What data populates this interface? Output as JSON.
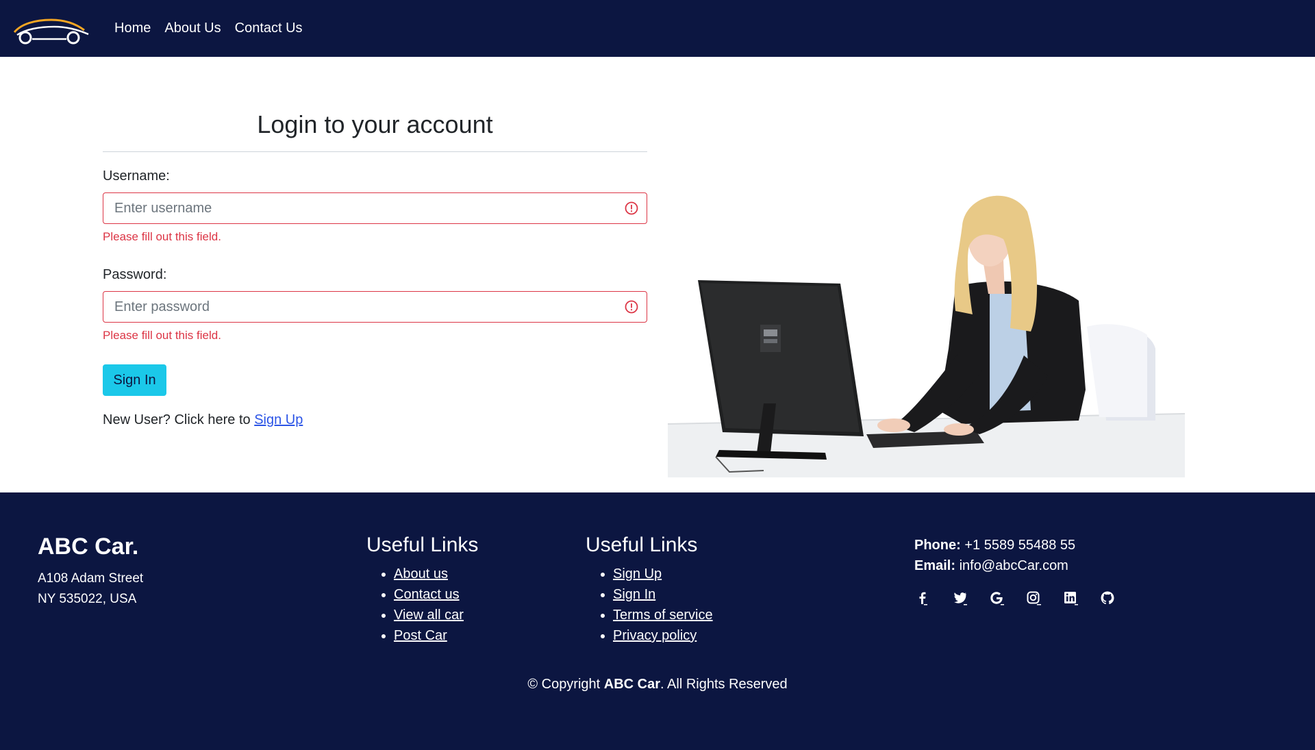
{
  "nav": {
    "logo_icon": "car-logo-icon",
    "links": [
      "Home",
      "About Us",
      "Contact Us"
    ]
  },
  "login": {
    "title": "Login to your account",
    "username_label": "Username:",
    "username_placeholder": "Enter username",
    "username_error": "Please fill out this field.",
    "password_label": "Password:",
    "password_placeholder": "Enter password",
    "password_error": "Please fill out this field.",
    "submit_label": "Sign In",
    "new_user_text": "New User? Click here to ",
    "signup_link": "Sign Up"
  },
  "footer": {
    "brand": "ABC Car.",
    "address_line1": "A108 Adam Street",
    "address_line2": "NY 535022, USA",
    "links1_title": "Useful Links",
    "links1": [
      "About us",
      "Contact us",
      "View all car",
      "Post Car"
    ],
    "links2_title": "Useful Links",
    "links2": [
      "Sign Up",
      "Sign In",
      "Terms of service",
      "Privacy policy"
    ],
    "phone_label": "Phone:",
    "phone_value": " +1 5589 55488 55",
    "email_label": "Email:",
    "email_value": " info@abcCar.com",
    "social_icons": [
      "facebook-icon",
      "twitter-icon",
      "google-icon",
      "instagram-icon",
      "linkedin-icon",
      "github-icon"
    ],
    "copyright_prefix": "© Copyright ",
    "copyright_brand": "ABC Car",
    "copyright_suffix": ". All Rights Reserved"
  },
  "colors": {
    "navy": "#0c1641",
    "error": "#dc3545",
    "button": "#1bc8e9",
    "link": "#2b54e6",
    "logo_accent": "#f5a623"
  }
}
